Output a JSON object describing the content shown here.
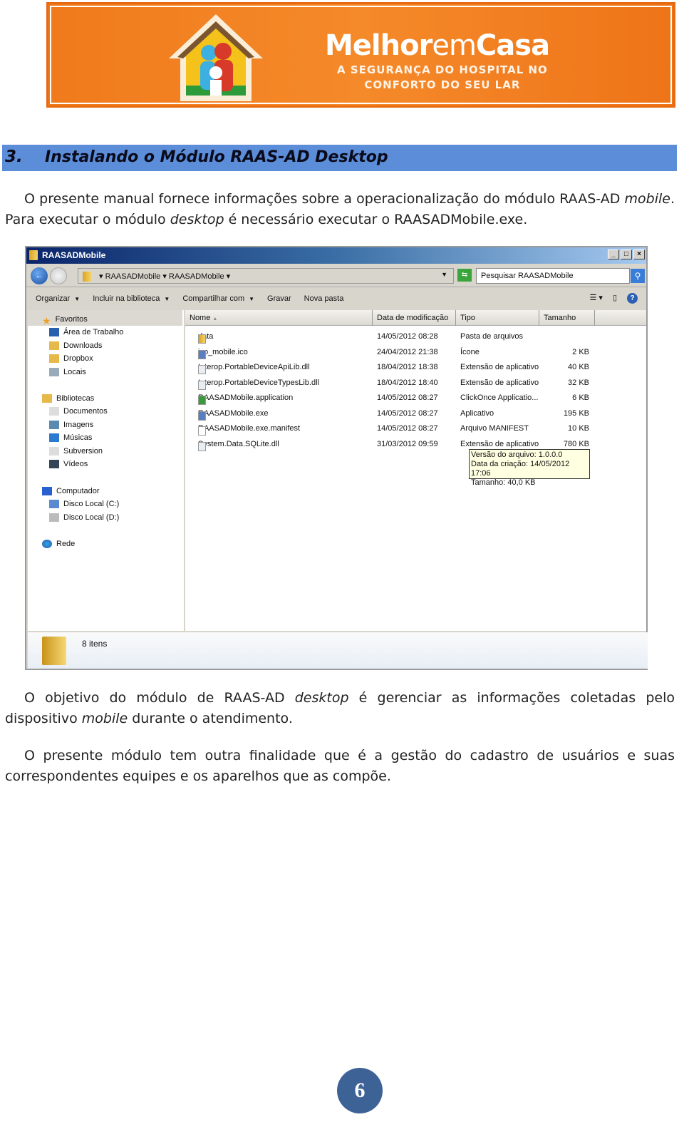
{
  "banner": {
    "brand_bold": "Melhor",
    "brand_light": "em",
    "brand_bold2": "Casa",
    "tagline_1": "A SEGURANÇA DO HOSPITAL NO",
    "tagline_2": "CONFORTO DO SEU LAR"
  },
  "section": {
    "number": "3.",
    "title": "Instalando o Módulo RAAS-AD Desktop"
  },
  "paragraphs": {
    "p1_a": "O presente manual fornece informações sobre a operacionalização do módulo RAAS-AD ",
    "p1_b": "mobile",
    "p1_c": ". Para executar o módulo ",
    "p1_d": "desktop",
    "p1_e": " é necessário executar o RAASADMobile.exe.",
    "p2_a": "O objetivo do módulo de RAAS-AD ",
    "p2_b": "desktop",
    "p2_c": " é gerenciar as informações coletadas pelo dispositivo ",
    "p2_d": "mobile",
    "p2_e": " durante o atendimento.",
    "p3": "O presente módulo tem outra finalidade que é a gestão do cadastro de usuários e suas correspondentes equipes e os aparelhos que as compõe."
  },
  "explorer": {
    "title": "RAASADMobile",
    "window_buttons": [
      "_",
      "□",
      "×"
    ],
    "breadcrumb": [
      "RAASADMobile",
      "RAASADMobile"
    ],
    "search_placeholder": "Pesquisar RAASADMobile",
    "toolbar": [
      "Organizar",
      "Incluir na biblioteca",
      "Compartilhar com",
      "Gravar",
      "Nova pasta"
    ],
    "columns": [
      "Nome",
      "Data de modificação",
      "Tipo",
      "Tamanho"
    ],
    "nav": {
      "favoritos": "Favoritos",
      "fav_items": [
        "Área de Trabalho",
        "Downloads",
        "Dropbox",
        "Locais"
      ],
      "bibliotecas": "Bibliotecas",
      "lib_items": [
        "Documentos",
        "Imagens",
        "Músicas",
        "Subversion",
        "Vídeos"
      ],
      "computador": "Computador",
      "comp_items": [
        "Disco Local (C:)",
        "Disco Local (D:)"
      ],
      "rede": "Rede"
    },
    "files": [
      {
        "name": "data",
        "date": "14/05/2012 08:28",
        "type": "Pasta de arquivos",
        "size": "",
        "icon": "folder"
      },
      {
        "name": "ico_mobile.ico",
        "date": "24/04/2012 21:38",
        "type": "Ícone",
        "size": "2 KB",
        "icon": "app"
      },
      {
        "name": "Interop.PortableDeviceApiLib.dll",
        "date": "18/04/2012 18:38",
        "type": "Extensão de aplicativo",
        "size": "40 KB",
        "icon": "dll"
      },
      {
        "name": "Interop.PortableDeviceTypesLib.dll",
        "date": "18/04/2012 18:40",
        "type": "Extensão de aplicativo",
        "size": "32 KB",
        "icon": "dll"
      },
      {
        "name": "RAASADMobile.application",
        "date": "14/05/2012 08:27",
        "type": "ClickOnce Applicatio...",
        "size": "6 KB",
        "icon": "clickonce"
      },
      {
        "name": "RAASADMobile.exe",
        "date": "14/05/2012 08:27",
        "type": "Aplicativo",
        "size": "195 KB",
        "icon": "app"
      },
      {
        "name": "RAASADMobile.exe.manifest",
        "date": "14/05/2012 08:27",
        "type": "Arquivo MANIFEST",
        "size": "10 KB",
        "icon": "file"
      },
      {
        "name": "System.Data.SQLite.dll",
        "date": "31/03/2012 09:59",
        "type": "Extensão de aplicativo",
        "size": "780 KB",
        "icon": "dll"
      }
    ],
    "tooltip": [
      "Versão do arquivo: 1.0.0.0",
      "Data da criação: 14/05/2012 17:06",
      "Tamanho: 40,0 KB"
    ],
    "status": "8 itens"
  },
  "page_number": "6",
  "colors": {
    "banner": "#f07a1c",
    "heading_bar": "#5b8dd8",
    "page_badge": "#3d6296"
  }
}
